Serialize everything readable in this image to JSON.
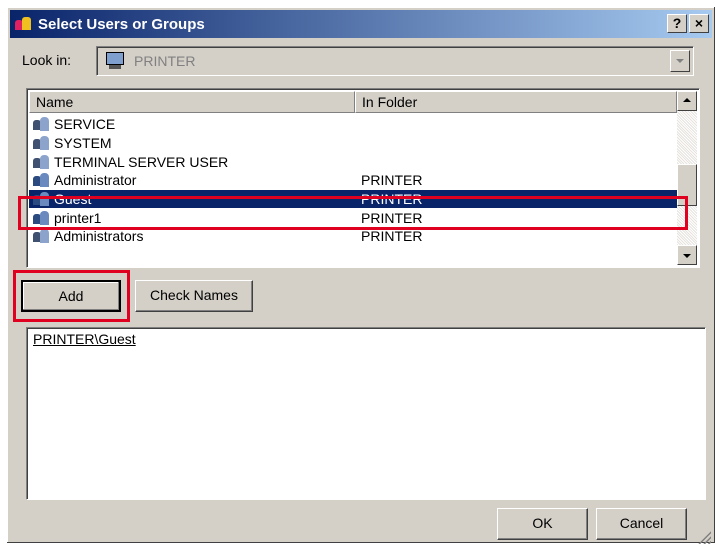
{
  "window": {
    "title": "Select Users or Groups",
    "help_label": "?",
    "close_label": "×"
  },
  "lookin": {
    "label": "Look in:",
    "value": "PRINTER"
  },
  "list": {
    "columns": [
      "Name",
      "In Folder"
    ],
    "rows": [
      {
        "name": "SERVICE",
        "folder": "",
        "icon": "group-icon"
      },
      {
        "name": "SYSTEM",
        "folder": "",
        "icon": "group-icon"
      },
      {
        "name": "TERMINAL SERVER USER",
        "folder": "",
        "icon": "group-icon"
      },
      {
        "name": "Administrator",
        "folder": "PRINTER",
        "icon": "user-icon"
      },
      {
        "name": "Guest",
        "folder": "PRINTER",
        "icon": "user-icon",
        "selected": true
      },
      {
        "name": "printer1",
        "folder": "PRINTER",
        "icon": "user-icon"
      },
      {
        "name": "Administrators",
        "folder": "PRINTER",
        "icon": "group-icon"
      }
    ]
  },
  "buttons": {
    "add": "Add",
    "check_names": "Check Names",
    "ok": "OK",
    "cancel": "Cancel"
  },
  "selected_entry": "PRINTER\\Guest",
  "colors": {
    "highlight_border": "#e00020",
    "selection_bg": "#0a246a"
  }
}
